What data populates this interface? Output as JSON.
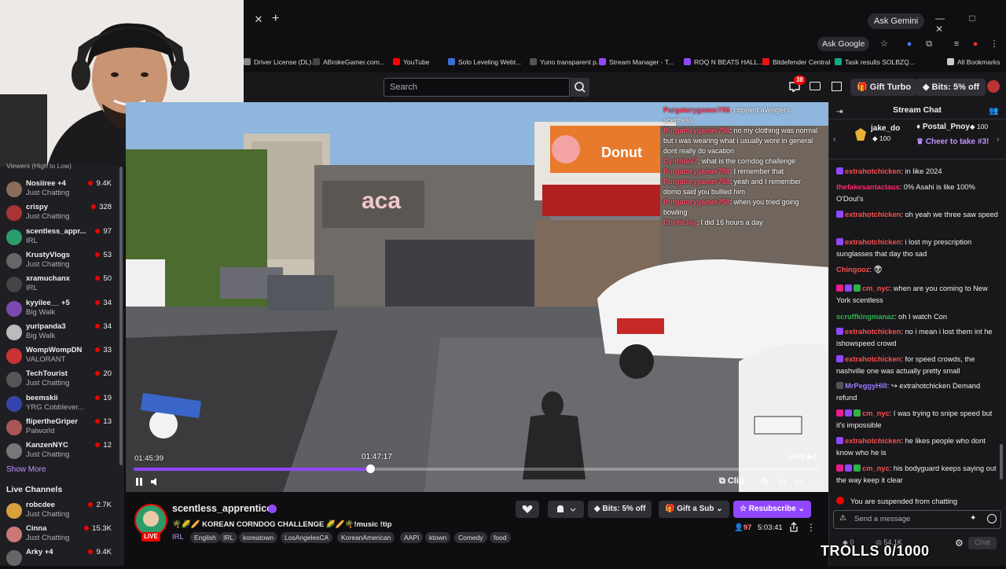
{
  "browser": {
    "ask_gemini": "Ask Gemini",
    "ask_google": "Ask Google",
    "window_controls": "— □ ✕",
    "bookmarks": [
      {
        "label": "Driver License (DL)...",
        "color": "#888"
      },
      {
        "label": "ABrokeGamer.com...",
        "color": "#444"
      },
      {
        "label": "YouTube",
        "color": "#ff0000"
      },
      {
        "label": "Solo Leveling Webt...",
        "color": "#3a6fd8"
      },
      {
        "label": "Yuno transparent p...",
        "color": "#555"
      },
      {
        "label": "Stream Manager - T...",
        "color": "#9147ff"
      },
      {
        "label": "ROQ N BEATS HALL...",
        "color": "#9147ff"
      },
      {
        "label": "Bitdefender Central",
        "color": "#e11"
      },
      {
        "label": "Task results SOLBZQ...",
        "color": "#1a8"
      },
      {
        "label": "All Bookmarks",
        "color": "#ccc"
      }
    ]
  },
  "topnav": {
    "search_placeholder": "Search",
    "notif_count": "38",
    "gift_turbo": "Gift Turbo",
    "bits_offer": "Bits: 5% off"
  },
  "sidebar": {
    "header": "Viewers (High to Low)",
    "followed": [
      {
        "name": "Nosiiree +4",
        "game": "Just Chatting",
        "viewers": "9.4K",
        "color": "#8a6d5a"
      },
      {
        "name": "crispy",
        "game": "Just Chatting",
        "viewers": "328",
        "color": "#a33"
      },
      {
        "name": "scentless_appr...",
        "game": "IRL",
        "viewers": "97",
        "color": "#2a9d6a"
      },
      {
        "name": "KrustyVlogs",
        "game": "Just Chatting",
        "viewers": "53",
        "color": "#666"
      },
      {
        "name": "xramuchanx",
        "game": "IRL",
        "viewers": "50",
        "color": "#444"
      },
      {
        "name": "kyyilee__ +5",
        "game": "Big Walk",
        "viewers": "34",
        "color": "#7a4ab0"
      },
      {
        "name": "yuripanda3",
        "game": "Big Walk",
        "viewers": "34",
        "color": "#bbb"
      },
      {
        "name": "WompWompDN",
        "game": "VALORANT",
        "viewers": "33",
        "color": "#c33"
      },
      {
        "name": "TechTourist",
        "game": "Just Chatting",
        "viewers": "20",
        "color": "#555"
      },
      {
        "name": "beemskii",
        "game": "YRG Cobblever...",
        "viewers": "19",
        "color": "#3344aa"
      },
      {
        "name": "fliperthеGriper",
        "game": "Palworld",
        "viewers": "13",
        "color": "#a55"
      },
      {
        "name": "KanzenNYC",
        "game": "Just Chatting",
        "viewers": "12",
        "color": "#777"
      }
    ],
    "show_more": "Show More",
    "live_channels_header": "Live Channels",
    "live": [
      {
        "name": "robcdee",
        "game": "Just Chatting",
        "viewers": "2.7K",
        "color": "#d9a13b"
      },
      {
        "name": "Cinna",
        "game": "Just Chatting",
        "viewers": "15.3K",
        "color": "#c77"
      },
      {
        "name": "Arky +4",
        "game": "",
        "viewers": "9.4K",
        "color": "#666"
      }
    ]
  },
  "player": {
    "current_time": "01:45:39",
    "hover_time": "01:47:17",
    "live_label": "LIVE",
    "clip_label": "Clip",
    "progress_fraction": 0.352,
    "overlay_chat": [
      {
        "user": "Purgatorygamer758",
        "text": "crippled avengers scentless"
      },
      {
        "user": "Purgatorygamer758",
        "text": "no my clothing was normal but i was wearing what i usually wore in general dont really do vacation"
      },
      {
        "user": "CynthiaV7",
        "text": "what is the corndog challenge"
      },
      {
        "user": "Purgatorygamer758",
        "text": "I remember that"
      },
      {
        "user": "Purgatorygamer758",
        "text": "yeah and I remember domo said you bullied him"
      },
      {
        "user": "Purgatorygamer758",
        "text": "when you tried going bowling"
      },
      {
        "user": "ChefieJay",
        "text": "I did 16 hours a day"
      }
    ]
  },
  "stream": {
    "streamer": "scentless_apprentice",
    "title": "🌴🌽🥖 KOREAN CORNDOG CHALLENGE 🌽🥖🌴!music !tip",
    "category": "IRL",
    "live_tag": "LIVE",
    "tags": [
      "English",
      "IRL",
      "koreatown",
      "LosAngelesCA",
      "KoreanAmerican",
      "AAPI",
      "ktown",
      "Comedy",
      "food"
    ],
    "bits_label": "Bits: 5% off",
    "gift_label": "Gift a Sub",
    "resub_label": "Resubscribe",
    "viewers": "97",
    "uptime": "5:03:41"
  },
  "chat": {
    "title": "Stream Chat",
    "leaderboard": [
      {
        "name": "jake_do",
        "amount": "100"
      },
      {
        "name": "Postal_Pnoy",
        "amount": "100"
      }
    ],
    "cheer_prompt": "Cheer to take #3!",
    "messages": [
      {
        "user": "extrahotchicken",
        "color": "#ff4d4d",
        "text": ": in like 2024",
        "badges": [
          "#9147ff"
        ]
      },
      {
        "user": "thefakesantaclaus",
        "color": "#ff2a6d",
        "text": ": 0% Asahi is like 100% O'Doul's",
        "badges": []
      },
      {
        "user": "extrahotchicken",
        "color": "#ff4d4d",
        "text": ": oh yeah we three saw speed",
        "badges": [
          "#9147ff"
        ]
      },
      {
        "user": "extrahotchicken",
        "color": "#ff4d4d",
        "text": ": i lost my prescription sunglasses that day tho sad",
        "badges": [
          "#9147ff"
        ]
      },
      {
        "user": "Chingooz",
        "color": "#ff4d4d",
        "text": ": 👽",
        "badges": []
      },
      {
        "user": "cm_nyc",
        "color": "#ff4d4d",
        "text": ": when are you coming to New York scentless",
        "badges": [
          "#e91e8c",
          "#9147ff",
          "#2fb24c"
        ]
      },
      {
        "user": "scruffkingmanaz",
        "color": "#2fb24c",
        "text": ": oh I watch Con",
        "badges": []
      },
      {
        "user": "extrahotchicken",
        "color": "#ff4d4d",
        "text": ": no i mean i lost them int he ishowspeed crowd",
        "badges": [
          "#9147ff"
        ]
      },
      {
        "user": "extrahotchicken",
        "color": "#ff4d4d",
        "text": ": for speed crowds, the nashville one was actually pretty small",
        "badges": [
          "#9147ff"
        ]
      },
      {
        "user": "MrPeggyHill",
        "color": "#9c7cff",
        "text": ": ↪ extrahotchicken Demand refund",
        "badges": [
          "#555"
        ]
      },
      {
        "user": "cm_nyc",
        "color": "#ff4d4d",
        "text": ": I was trying to snipe speed but it's impossible",
        "badges": [
          "#e91e8c",
          "#9147ff",
          "#2fb24c"
        ]
      },
      {
        "user": "extrahotchicken",
        "color": "#ff4d4d",
        "text": ": he likes people who dont know who he is",
        "badges": [
          "#9147ff"
        ]
      },
      {
        "user": "cm_nyc",
        "color": "#ff4d4d",
        "text": ": his bodyguard keeps saying out the way keep it clear",
        "badges": [
          "#e91e8c",
          "#9147ff",
          "#2fb24c"
        ]
      }
    ],
    "suspended": "You are suspended from chatting",
    "input_placeholder": "Send a message",
    "bits": "0",
    "points": "54.1K",
    "chat_button": "Chat"
  },
  "overlay": {
    "trolls": "TROLLS 0/1000"
  }
}
